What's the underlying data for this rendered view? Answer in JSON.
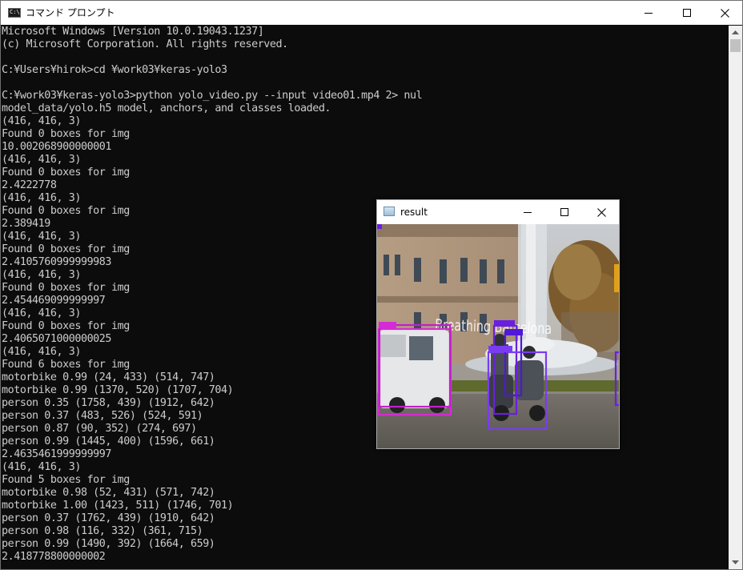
{
  "cmd_window": {
    "title": "コマンド プロンプト",
    "icon_text": "C:\\.",
    "controls": {
      "minimize": "minimize-icon",
      "maximize": "maximize-icon",
      "close": "close-icon"
    }
  },
  "console": {
    "lines": [
      "Microsoft Windows [Version 10.0.19043.1237]",
      "(c) Microsoft Corporation. All rights reserved.",
      "",
      "C:¥Users¥hirok>cd ¥work03¥keras-yolo3",
      "",
      "C:¥work03¥keras-yolo3>python yolo_video.py --input video01.mp4 2> nul",
      "model_data/yolo.h5 model, anchors, and classes loaded.",
      "(416, 416, 3)",
      "Found 0 boxes for img",
      "10.002068900000001",
      "(416, 416, 3)",
      "Found 0 boxes for img",
      "2.4222778",
      "(416, 416, 3)",
      "Found 0 boxes for img",
      "2.389419",
      "(416, 416, 3)",
      "Found 0 boxes for img",
      "2.4105760999999983",
      "(416, 416, 3)",
      "Found 0 boxes for img",
      "2.454469099999997",
      "(416, 416, 3)",
      "Found 0 boxes for img",
      "2.4065071000000025",
      "(416, 416, 3)",
      "Found 6 boxes for img",
      "motorbike 0.99 (24, 433) (514, 747)",
      "motorbike 0.99 (1370, 520) (1707, 704)",
      "person 0.35 (1758, 439) (1912, 642)",
      "person 0.37 (483, 526) (524, 591)",
      "person 0.87 (90, 352) (274, 697)",
      "person 0.99 (1445, 400) (1596, 661)",
      "2.4635461999999997",
      "(416, 416, 3)",
      "Found 5 boxes for img",
      "motorbike 0.98 (52, 431) (571, 742)",
      "motorbike 1.00 (1423, 511) (1746, 701)",
      "person 0.37 (1762, 439) (1910, 642)",
      "person 0.98 (116, 332) (361, 715)",
      "person 0.99 (1490, 392) (1664, 659)",
      "2.418778800000002"
    ]
  },
  "result_window": {
    "title": "result",
    "overlay_text": "Breathing Barcelona",
    "box_colors": {
      "magenta": "#d52bd6",
      "purple": "#6a1fe0",
      "violet": "#7a3cf0"
    }
  },
  "colors": {
    "console_bg": "#0c0c0c",
    "console_fg": "#cccccc",
    "titlebar_bg": "#ffffff"
  }
}
